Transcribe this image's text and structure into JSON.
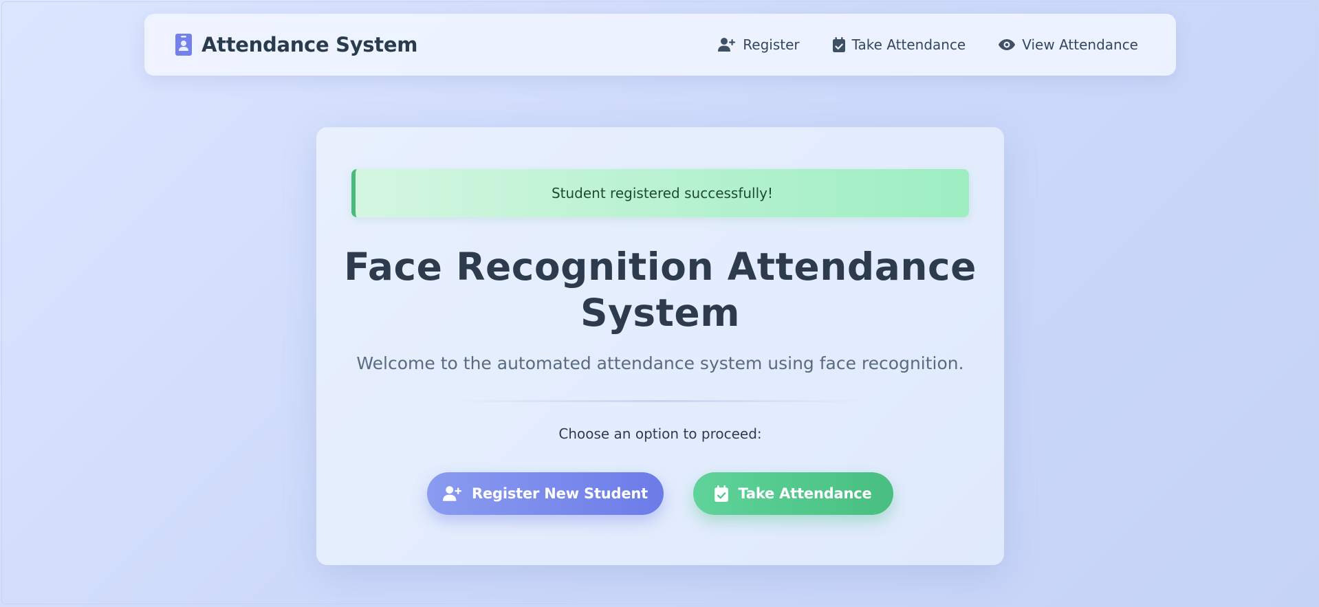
{
  "colors": {
    "brand_icon": "#6c7ce8",
    "register_button": "#7686ec",
    "attendance_button": "#52c98b",
    "success_accent": "#48bb78",
    "heading_text": "#2d3b4d"
  },
  "navbar": {
    "brand_icon": "id-badge-icon",
    "brand_title": "Attendance System",
    "links": [
      {
        "label": "Register",
        "icon": "user-plus-icon"
      },
      {
        "label": "Take Attendance",
        "icon": "calendar-check-icon"
      },
      {
        "label": "View Attendance",
        "icon": "eye-icon"
      }
    ]
  },
  "main": {
    "alert": "Student registered successfully!",
    "title": "Face Recognition Attendance System",
    "subtitle": "Welcome to the automated attendance system using face recognition.",
    "prompt": "Choose an option to proceed:",
    "buttons": {
      "register": {
        "label": "Register New Student",
        "icon": "user-plus-icon"
      },
      "attendance": {
        "label": "Take Attendance",
        "icon": "calendar-check-icon"
      }
    }
  }
}
